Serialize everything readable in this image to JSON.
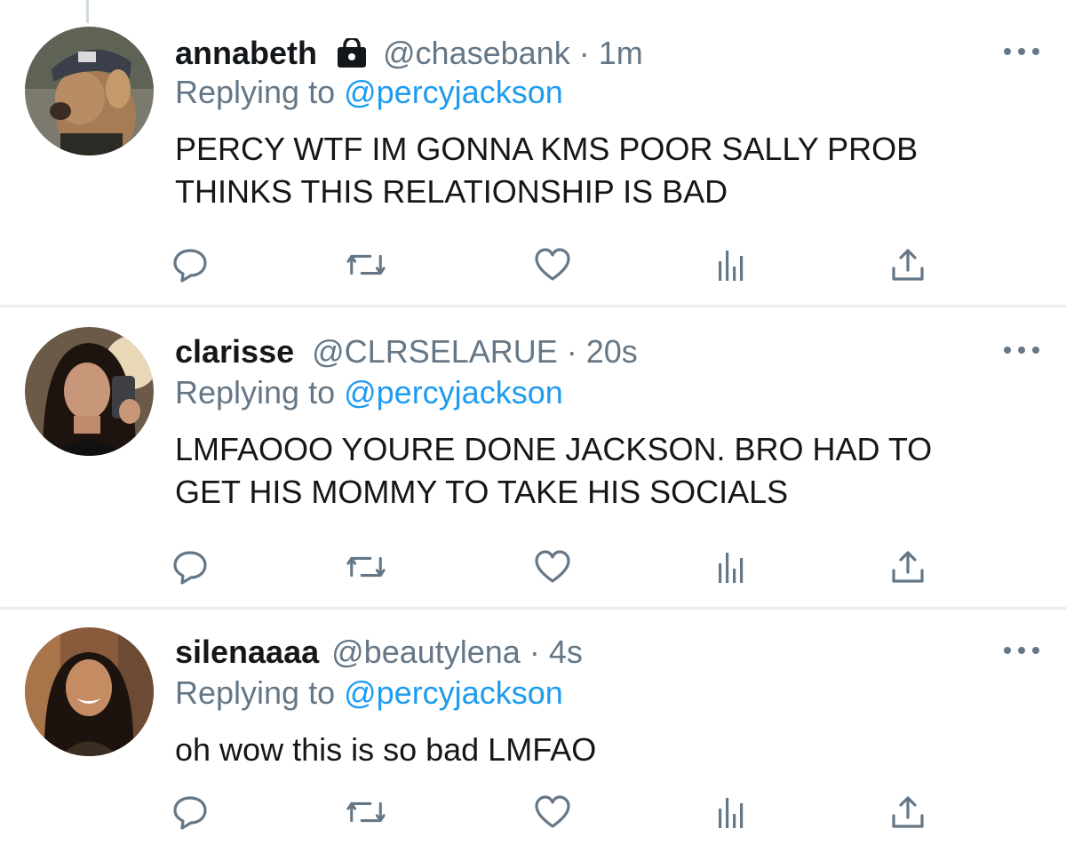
{
  "tweets": [
    {
      "display_name": "annabeth",
      "locked": true,
      "handle": "@chasebank",
      "separator": "·",
      "time": "1m",
      "replying_prefix": "Replying to",
      "replying_to": "@percyjackson",
      "text_lines": [
        "PERCY WTF IM GONNA KMS POOR SALLY PROB",
        "THINKS THIS RELATIONSHIP IS BAD"
      ],
      "avatar": "fawn-in-cap"
    },
    {
      "display_name": "clarisse",
      "locked": false,
      "handle": "@CLRSELARUE",
      "separator": "·",
      "time": "20s",
      "replying_prefix": "Replying to",
      "replying_to": "@percyjackson",
      "text_lines": [
        "LMFAOOO YOURE DONE JACKSON. BRO HAD TO",
        "GET HIS MOMMY TO TAKE HIS SOCIALS"
      ],
      "avatar": "mirror-selfie"
    },
    {
      "display_name": "silenaaaa",
      "locked": false,
      "handle": "@beautylena",
      "separator": "·",
      "time": "4s",
      "replying_prefix": "Replying to",
      "replying_to": "@percyjackson",
      "text_lines": [
        "oh wow this is so bad LMFAO"
      ],
      "avatar": "smiling-woman"
    }
  ],
  "icons": {
    "lock": "lock-icon",
    "more": "more-icon",
    "reply": "reply-icon",
    "retweet": "retweet-icon",
    "like": "like-icon",
    "analytics": "analytics-icon",
    "share": "share-icon"
  },
  "colors": {
    "link": "#1d9bf0",
    "secondary": "#657786",
    "primary": "#14171a",
    "divider": "#e6ecf0"
  }
}
